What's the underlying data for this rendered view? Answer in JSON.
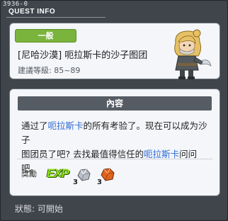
{
  "window": {
    "id": "3936-0",
    "title": "QUEST INFO"
  },
  "quest": {
    "category": "一般",
    "name": "[尼哈沙漠] 呃拉斯卡的沙子图团",
    "level": "建議等級: 85~89"
  },
  "content": {
    "header": "內容",
    "line1_a": "通过了",
    "line1_name": "呃拉斯卡",
    "line1_b": "的所有考验了。现在可以成为沙子",
    "line2_a": "图团员了吧? 去找最值得信任的",
    "line2_name": "呃拉斯卡",
    "line2_b": "问问吧。"
  },
  "reward": {
    "label": "獎勵",
    "exp_label": "EXP",
    "items": [
      {
        "icon": "silver-ore-icon",
        "qty": "3"
      },
      {
        "icon": "orange-ore-icon",
        "qty": "3"
      }
    ]
  },
  "status": {
    "text": "狀態:  可開始"
  },
  "colors": {
    "window_bg": "#40454c",
    "card_bg": "#f4f6f9",
    "category_tag": "#7ab43c",
    "highlight": "#2f6ad6",
    "exp_text": "#8fe21a"
  }
}
